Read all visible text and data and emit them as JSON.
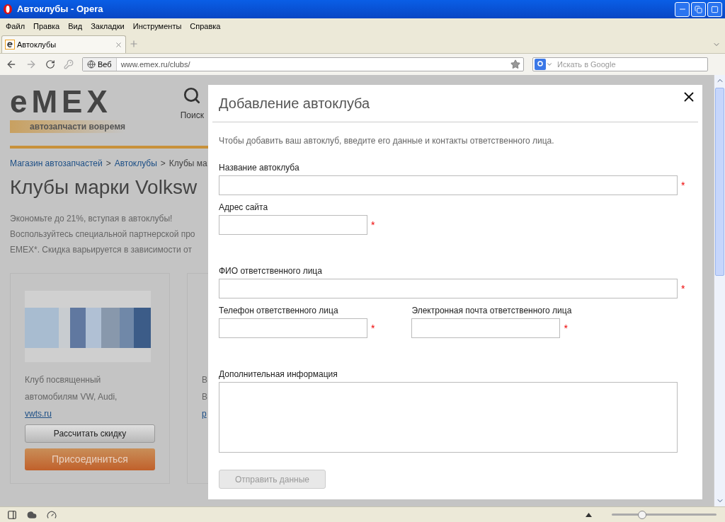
{
  "window": {
    "title": "Автоклубы - Opera"
  },
  "menu": [
    "Файл",
    "Правка",
    "Вид",
    "Закладки",
    "Инструменты",
    "Справка"
  ],
  "tabs": [
    {
      "label": "Автоклубы",
      "selected": true
    }
  ],
  "address_bar": {
    "badge": "Веб",
    "url": "www.emex.ru/clubs/"
  },
  "search": {
    "placeholder": "Искать в Google"
  },
  "page": {
    "logo": "eMEX",
    "tagline": "автозапчасти вовремя",
    "search_label": "Поиск",
    "breadcrumbs": [
      {
        "label": "Магазин автозапчастей",
        "link": true
      },
      {
        "label": ">",
        "link": false
      },
      {
        "label": "Автоклубы",
        "link": true
      },
      {
        "label": ">",
        "link": false
      },
      {
        "label": "Клубы ма",
        "link": false
      }
    ],
    "heading": "Клубы марки Volksw",
    "intro": [
      "Экономьте до 21%, вступая в автоклубы!",
      "Воспользуйтесь специальной партнерской про",
      "EMEX*. Скидка варьируется в зависимости от"
    ],
    "cards": [
      {
        "description": [
          "Клуб посвященный",
          "автомобилям VW, Audi,"
        ],
        "link": "vwts.ru",
        "calc_button": "Рассчитать скидку",
        "join_button": "Присоединиться"
      },
      {
        "description": [
          "В",
          "В"
        ],
        "link": "р"
      }
    ]
  },
  "dialog": {
    "title": "Добавление автоклуба",
    "intro": "Чтобы добавить ваш автоклуб, введите его данные и контакты ответственного лица.",
    "rows": [
      [
        {
          "label": "Название автоклуба",
          "kind": "wide",
          "required_mark": "*"
        }
      ],
      [
        {
          "label": "Адрес сайта",
          "kind": "short",
          "required_mark": "*"
        }
      ],
      [
        {
          "label": "ФИО ответственного лица",
          "kind": "wide",
          "required_mark": "*"
        }
      ],
      [
        {
          "label": "Телефон ответственного лица",
          "kind": "short",
          "required_mark": "*"
        },
        {
          "label": "Электронная почта ответственного лица",
          "kind": "short",
          "required_mark": "*"
        }
      ],
      [
        {
          "label": "Дополнительная информация",
          "kind": "textarea"
        }
      ]
    ],
    "submit": {
      "label": "Отправить данные",
      "disabled": true
    }
  },
  "status_bar": {
    "zoom": {
      "level": 0.27
    }
  }
}
